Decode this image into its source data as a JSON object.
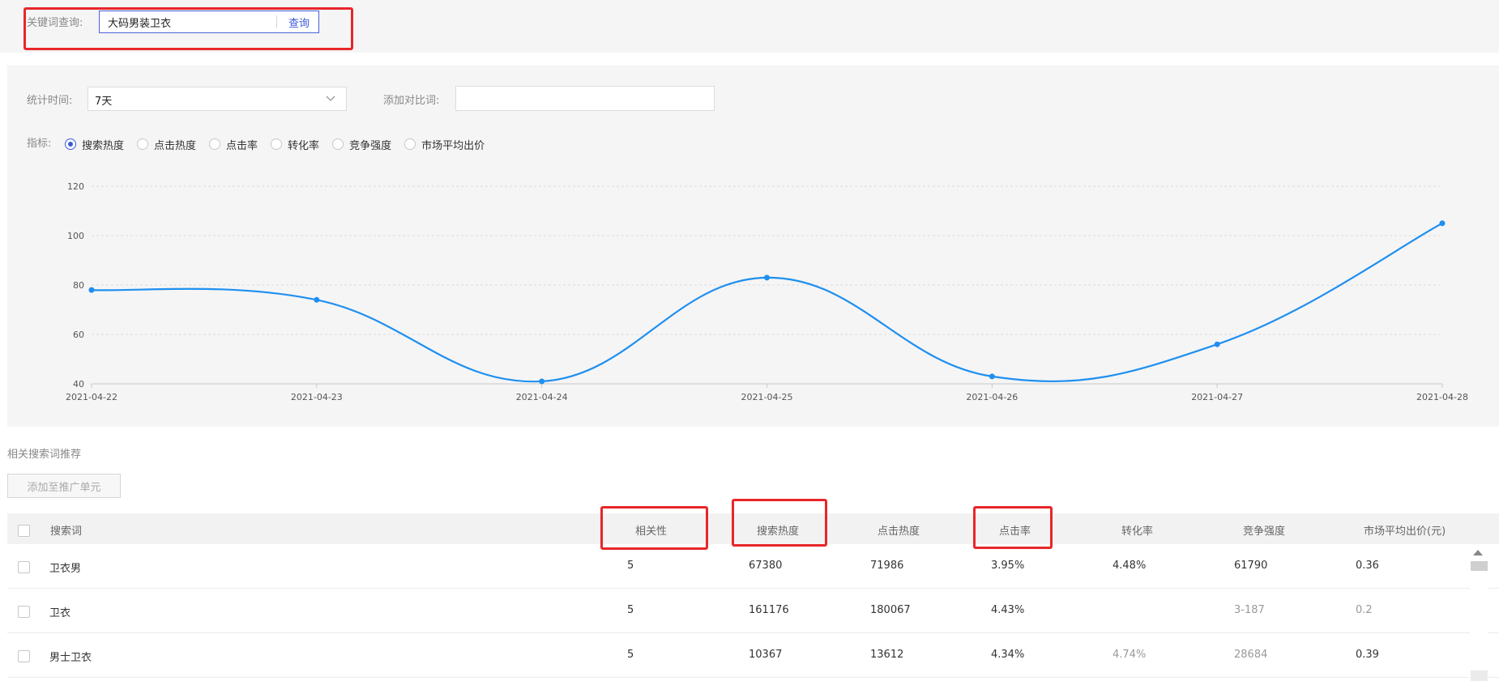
{
  "search": {
    "label": "关键词查询:",
    "keyword": "大码男装卫衣",
    "button": "查询"
  },
  "filters": {
    "time_label": "统计时间:",
    "time_value": "7天",
    "compare_label": "添加对比词:",
    "compare_value": "",
    "metric_label": "指标:",
    "metrics": [
      {
        "label": "搜索热度",
        "selected": true
      },
      {
        "label": "点击热度",
        "selected": false
      },
      {
        "label": "点击率",
        "selected": false
      },
      {
        "label": "转化率",
        "selected": false
      },
      {
        "label": "竞争强度",
        "selected": false
      },
      {
        "label": "市场平均出价",
        "selected": false
      }
    ]
  },
  "chart_data": {
    "type": "line",
    "x": [
      "2021-04-22",
      "2021-04-23",
      "2021-04-24",
      "2021-04-25",
      "2021-04-26",
      "2021-04-27",
      "2021-04-28"
    ],
    "series": [
      {
        "values": [
          78,
          74,
          41,
          83,
          43,
          56,
          105
        ]
      }
    ],
    "ylim": [
      40,
      120
    ],
    "yticks": [
      40,
      60,
      80,
      100,
      120
    ],
    "grid": true,
    "line_color": "#1e8ff0"
  },
  "related": {
    "title": "相关搜索词推荐",
    "add_button": "添加至推广单元",
    "columns": [
      "搜索词",
      "相关性",
      "搜索热度",
      "点击热度",
      "点击率",
      "转化率",
      "竞争强度",
      "市场平均出价(元)"
    ],
    "rows": [
      [
        "卫衣男",
        "5",
        "67380",
        "71986",
        "3.95%",
        "4.48%",
        "61790",
        "0.36"
      ],
      [
        "卫衣",
        "5",
        "161176",
        "180067",
        "4.43%",
        "",
        "3-187",
        "0.2"
      ],
      [
        "男士卫衣",
        "5",
        "10367",
        "13612",
        "4.34%",
        "4.74%",
        "28684",
        "0.39"
      ]
    ]
  },
  "colors": {
    "accent": "#3b5ad6",
    "highlight": "#e8262a"
  }
}
